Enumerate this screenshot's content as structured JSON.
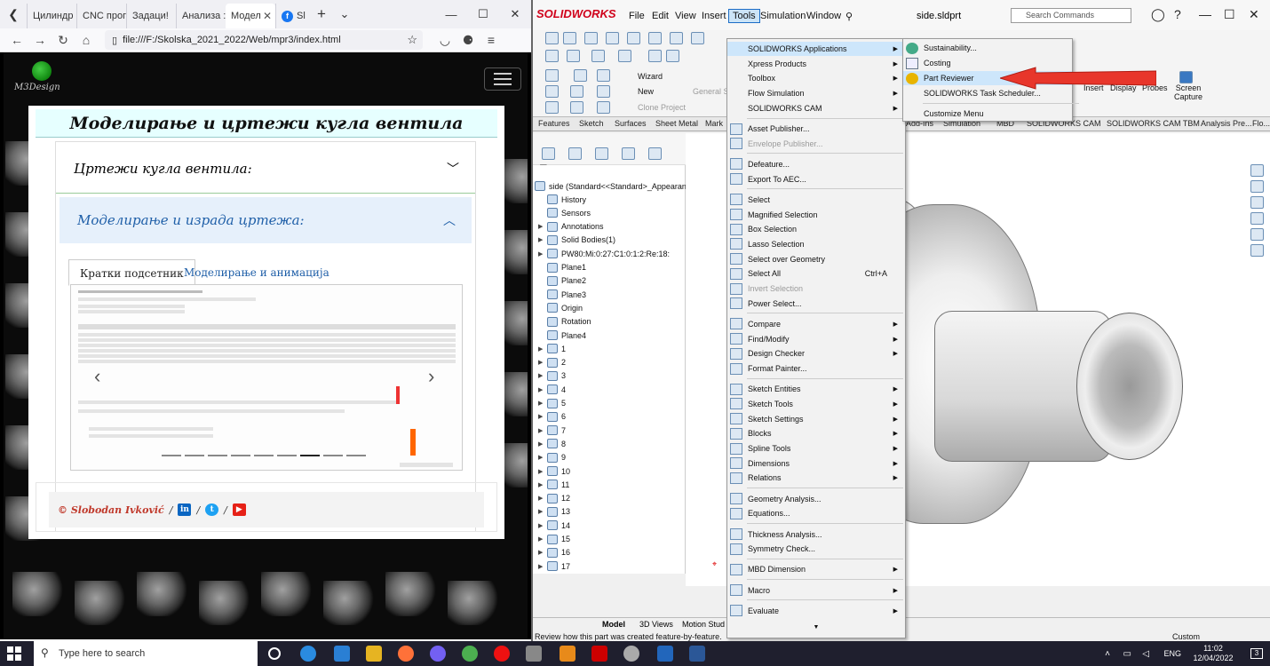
{
  "browser": {
    "tabs": [
      "Цилиндр",
      "CNC прог",
      "Задаци!",
      "Анализа :",
      "Модел",
      "Sl"
    ],
    "url": "file:///F:/Skolska_2021_2022/Web/mpr3/index.html",
    "logo_text": "M3Design",
    "page_title": "Моделирање и цртежи кугла вентила",
    "accordion": [
      {
        "label": "Цртежи кугла вентила:"
      },
      {
        "label": "Моделирање и израда цртежа:"
      }
    ],
    "inner_tabs": [
      "Кратки подсетник",
      "Моделирање и анимација"
    ],
    "footer_author": "© Slobodan Ivković",
    "social": [
      "in",
      "t",
      "▶"
    ]
  },
  "solidworks": {
    "brand": "SOLIDWORKS",
    "menus": [
      "File",
      "Edit",
      "View",
      "Insert",
      "Tools",
      "Simulation",
      "Window"
    ],
    "filename": "side.sldprt",
    "search_placeholder": "Search Commands",
    "cmd_labels": {
      "wizard": "Wizard",
      "new": "New",
      "general_settings": "General Settings",
      "clone_project": "Clone Project",
      "insert": "Insert",
      "display": "Display",
      "probes": "Probes",
      "screen_capture": "Screen Capture"
    },
    "cmd_tabs": [
      "Features",
      "Sketch",
      "Surfaces",
      "Sheet Metal",
      "Mark",
      "Add-Ins",
      "Simulation",
      "MBD",
      "SOLIDWORKS CAM",
      "SOLIDWORKS CAM TBM",
      "Analysis Pre...",
      "Flo..."
    ],
    "tree": {
      "root": "side  (Standard<<Standard>_Appearan",
      "items": [
        "History",
        "Sensors",
        "Annotations",
        "Solid Bodies(1)",
        "PW80:Mi:0:27:C1:0:1:2:Re:18:",
        "Plane1",
        "Plane2",
        "Plane3",
        "Origin",
        "Rotation",
        "Plane4",
        "1",
        "2",
        "3",
        "4",
        "5",
        "6",
        "7",
        "8",
        "9",
        "10",
        "11",
        "12",
        "13",
        "14",
        "15",
        "16",
        "17"
      ]
    },
    "tools_menu": [
      {
        "label": "SOLIDWORKS Applications",
        "sub": true
      },
      {
        "label": "Xpress Products",
        "sub": true
      },
      {
        "label": "Toolbox",
        "sub": true
      },
      {
        "label": "Flow Simulation",
        "sub": true
      },
      {
        "label": "SOLIDWORKS CAM",
        "sub": true
      },
      {
        "label": "Asset Publisher..."
      },
      {
        "label": "Envelope Publisher...",
        "disabled": true
      },
      {
        "label": "Defeature..."
      },
      {
        "label": "Export To AEC..."
      },
      {
        "label": "Select"
      },
      {
        "label": "Magnified Selection"
      },
      {
        "label": "Box Selection"
      },
      {
        "label": "Lasso Selection"
      },
      {
        "label": "Select over Geometry"
      },
      {
        "label": "Select All",
        "shortcut": "Ctrl+A"
      },
      {
        "label": "Invert Selection",
        "disabled": true
      },
      {
        "label": "Power Select..."
      },
      {
        "label": "Compare",
        "sub": true
      },
      {
        "label": "Find/Modify",
        "sub": true
      },
      {
        "label": "Design Checker",
        "sub": true
      },
      {
        "label": "Format Painter..."
      },
      {
        "label": "Sketch Entities",
        "sub": true
      },
      {
        "label": "Sketch Tools",
        "sub": true
      },
      {
        "label": "Sketch Settings",
        "sub": true
      },
      {
        "label": "Blocks",
        "sub": true
      },
      {
        "label": "Spline Tools",
        "sub": true
      },
      {
        "label": "Dimensions",
        "sub": true
      },
      {
        "label": "Relations",
        "sub": true
      },
      {
        "label": "Geometry Analysis..."
      },
      {
        "label": "Equations..."
      },
      {
        "label": "Thickness Analysis..."
      },
      {
        "label": "Symmetry Check..."
      },
      {
        "label": "MBD Dimension",
        "sub": true
      },
      {
        "label": "Macro",
        "sub": true
      },
      {
        "label": "Evaluate",
        "sub": true
      }
    ],
    "apps_submenu": [
      "Sustainability...",
      "Costing",
      "Part Reviewer",
      "SOLIDWORKS Task Scheduler...",
      "Customize Menu"
    ],
    "model_tabs": [
      "Model",
      "3D Views",
      "Motion Stud"
    ],
    "status_text": "Review how this part was created feature-by-feature.",
    "units": "Custom"
  },
  "taskbar": {
    "search_placeholder": "Type here to search",
    "lang": "ENG",
    "time": "11:02",
    "date": "12/04/2022",
    "notifications": "3"
  },
  "colors": {
    "accent_blue": "#1f5fa8",
    "highlight": "#cde6fb",
    "arrow_red": "#e8362b",
    "sw_red": "#d0021b"
  }
}
